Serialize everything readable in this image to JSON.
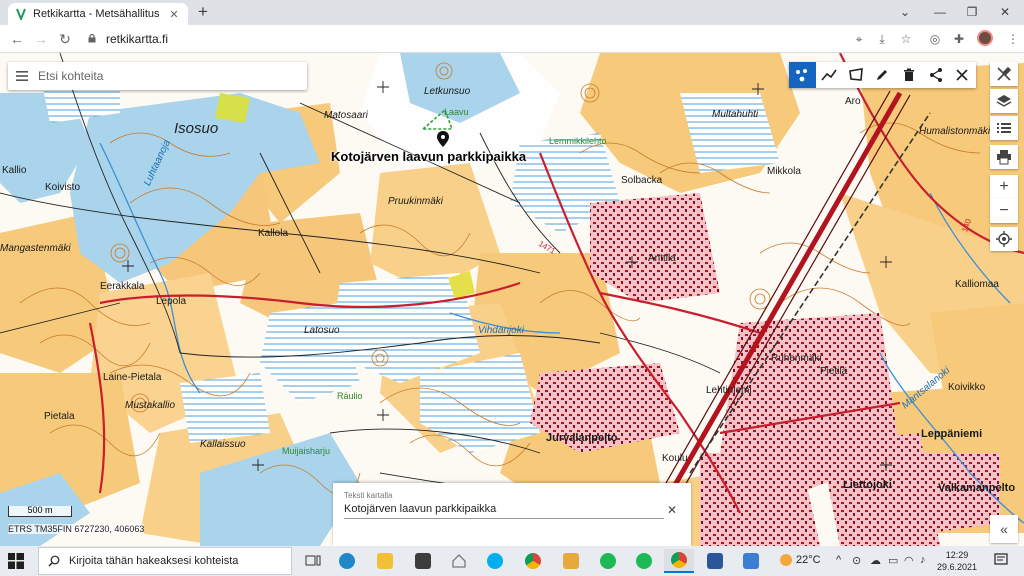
{
  "browser": {
    "tab_title": "Retkikartta - Metsähallitus",
    "url": "retkikartta.fi",
    "new_tab_symbol": "+",
    "tab_close_symbol": "✕"
  },
  "map": {
    "search_placeholder": "Etsi kohteita",
    "poi_title": "Kotojärven laavun parkkipaikka",
    "scale_label": "500 m",
    "coords_label": "ETRS TM35FIN  6727230, 406063",
    "text_panel": {
      "label": "Teksti kartalla",
      "value": "Kotojärven laavun parkkipaikka"
    },
    "zoom_in": "+",
    "zoom_out": "−",
    "collapse_symbol": "«",
    "place_labels": [
      "Isosuo",
      "Letkunsuo",
      "Matosaari",
      "Laavu",
      "Lemmikkilehto",
      "Aro",
      "Multahuhti",
      "Humalistonmäki",
      "Mikkola",
      "Solbacka",
      "Kallio",
      "Koivisto",
      "Kallola",
      "Pruukinmäki",
      "Anttila",
      "Kalliomaa",
      "Mangastenmäki",
      "Eerakkala",
      "Lepola",
      "Latosuo",
      "Ruhenmäki",
      "Pietilä",
      "Koivikko",
      "Laine-Pietala",
      "Mustakallio",
      "Pietala",
      "Räulio",
      "Kallaissuo",
      "Muijaisharju",
      "Jurvalanpelto",
      "Leppäniemi",
      "Liettojoki",
      "Valkamanpelto",
      "Koulu",
      "Luhtaanoja",
      "Mantsalanoki",
      "Vihdanjoki",
      "Lehtiniemi"
    ],
    "route_number": "1471",
    "road_number": "140"
  },
  "taskbar": {
    "search_placeholder": "Kirjoita tähän hakeaksesi kohteista",
    "temperature": "22°C",
    "time": "12:29",
    "date": "29.6.2021"
  },
  "colors": {
    "forest_fill": "#f7c97a",
    "water_fill": "#a9d4ec",
    "marsh_blue": "#5aa6dd",
    "contour_brown": "#c87a2a",
    "road_red": "#c81e2e",
    "urban_pink": "#f5c1c8",
    "accent_blue": "#1565c0"
  }
}
